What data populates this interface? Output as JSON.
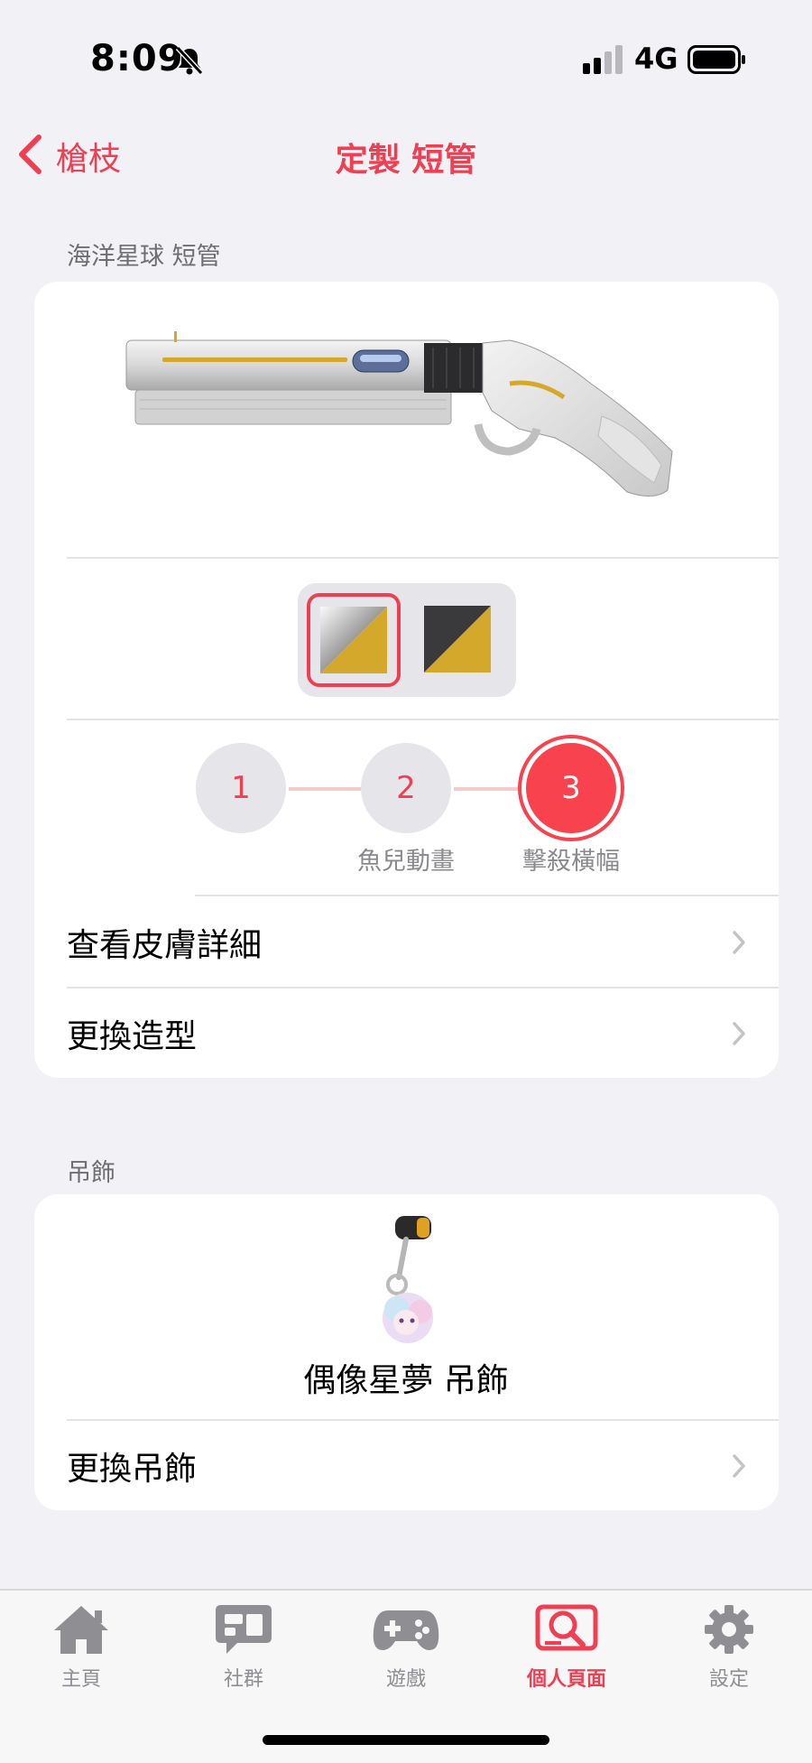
{
  "status_bar": {
    "time": "8:09",
    "network": "4G"
  },
  "nav": {
    "back_label": "槍枝",
    "title": "定製 短管"
  },
  "weapon_section": {
    "label": "海洋星球 短管",
    "variants": [
      {
        "name": "silver-gold",
        "selected": true,
        "colors": [
          "#e9e9e9",
          "#d4a82a"
        ]
      },
      {
        "name": "dark-gold",
        "selected": false,
        "colors": [
          "#3a3a3c",
          "#d4a82a"
        ]
      }
    ],
    "steps": [
      {
        "number": "1",
        "caption": ""
      },
      {
        "number": "2",
        "caption": "魚兒動畫"
      },
      {
        "number": "3",
        "caption": "擊殺橫幅",
        "active": true
      }
    ],
    "rows": [
      {
        "label": "查看皮膚詳細"
      },
      {
        "label": "更換造型"
      }
    ]
  },
  "charm_section": {
    "label": "吊飾",
    "charm_name": "偶像星夢 吊飾",
    "rows": [
      {
        "label": "更換吊飾"
      }
    ]
  },
  "tabs": [
    {
      "label": "主頁",
      "icon": "home-icon"
    },
    {
      "label": "社群",
      "icon": "chat-icon"
    },
    {
      "label": "遊戲",
      "icon": "gamepad-icon"
    },
    {
      "label": "個人頁面",
      "icon": "profile-search-icon",
      "active": true
    },
    {
      "label": "設定",
      "icon": "gear-icon"
    }
  ],
  "colors": {
    "accent": "#ef3f53",
    "background": "#f2f1f6"
  }
}
